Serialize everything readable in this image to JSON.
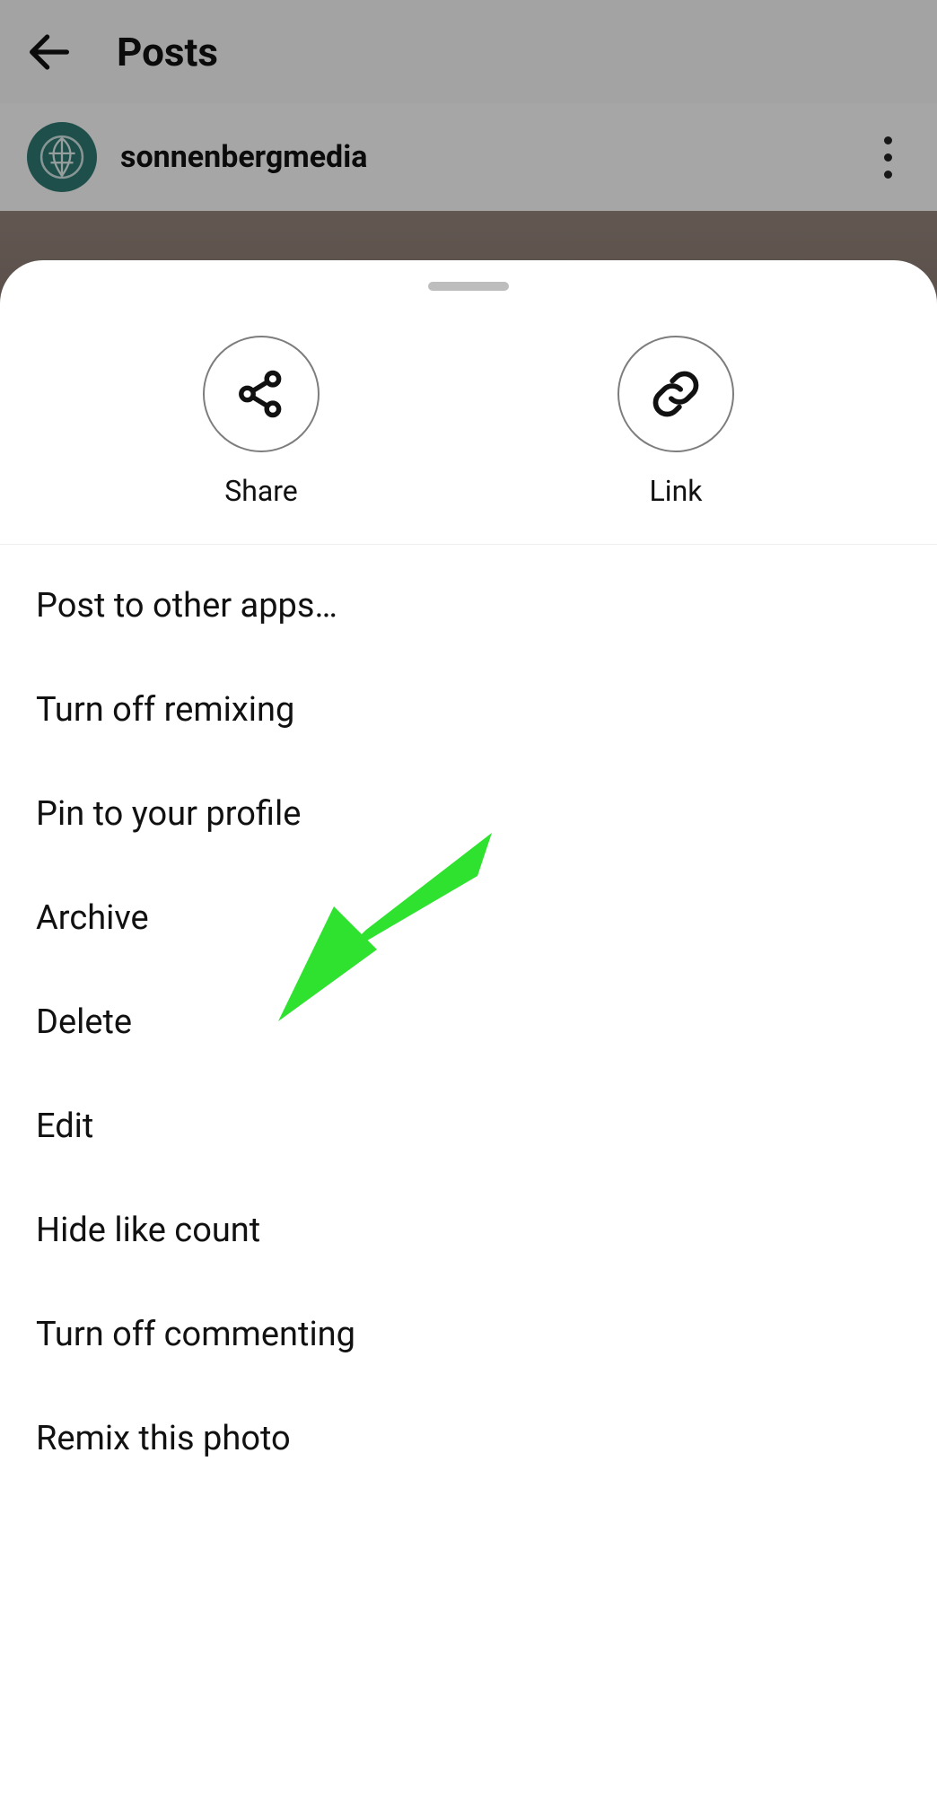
{
  "header": {
    "title": "Posts",
    "username": "sonnenbergmedia"
  },
  "sheet": {
    "quick": {
      "share_label": "Share",
      "link_label": "Link"
    },
    "menu": [
      "Post to other apps…",
      "Turn off remixing",
      "Pin to your profile",
      "Archive",
      "Delete",
      "Edit",
      "Hide like count",
      "Turn off commenting",
      "Remix this photo"
    ]
  },
  "annotation": {
    "arrow_color": "#2fe22f",
    "points_to": "Pin to your profile"
  }
}
